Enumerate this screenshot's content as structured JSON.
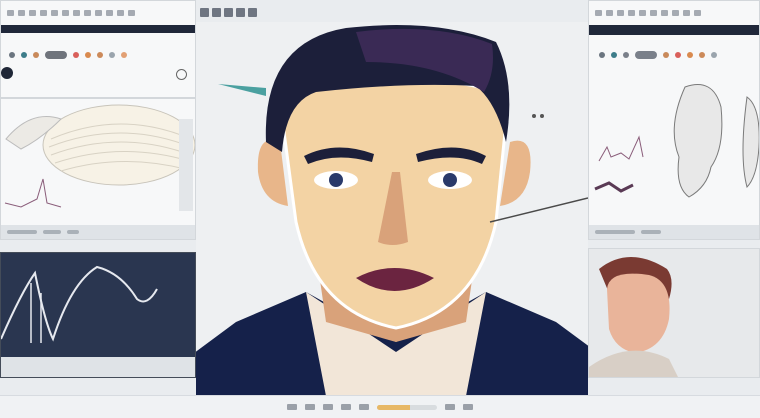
{
  "window": {
    "title_text": ""
  },
  "left_top_panel": {
    "color_dots": [
      "#6b7580",
      "#3d7d8a",
      "#c98a5b",
      "#d9605b",
      "#d98a4f",
      "#cc8a5a",
      "#9aa4ad",
      "#e2a074"
    ],
    "selected_pill": "#6f747c"
  },
  "left_mid_panel": {
    "preview": "feather-shape"
  },
  "left_bottom_panel": {
    "preview": "waveform-chart"
  },
  "right_top_panel": {
    "color_dots": [
      "#6b7580",
      "#3d7d8a",
      "#7a808a",
      "#c98a5b",
      "#d9605b",
      "#d98a4f",
      "#cc8a5a",
      "#9aa4ad"
    ]
  },
  "right_bottom_panel": {
    "preview": "photo-portrait"
  },
  "center_canvas": {
    "subject": "illustrated-portrait",
    "colors": {
      "hair": "#1c1f3a",
      "hair_highlight": "#3a2a55",
      "skin": "#f3d3a4",
      "skin_shadow": "#d9a27a",
      "lips": "#6b2440",
      "jacket": "#15214a",
      "shirt": "#f2e6d8",
      "accent": "#4aa0a0"
    }
  },
  "bottom_bar": {
    "progress": 0.55
  }
}
